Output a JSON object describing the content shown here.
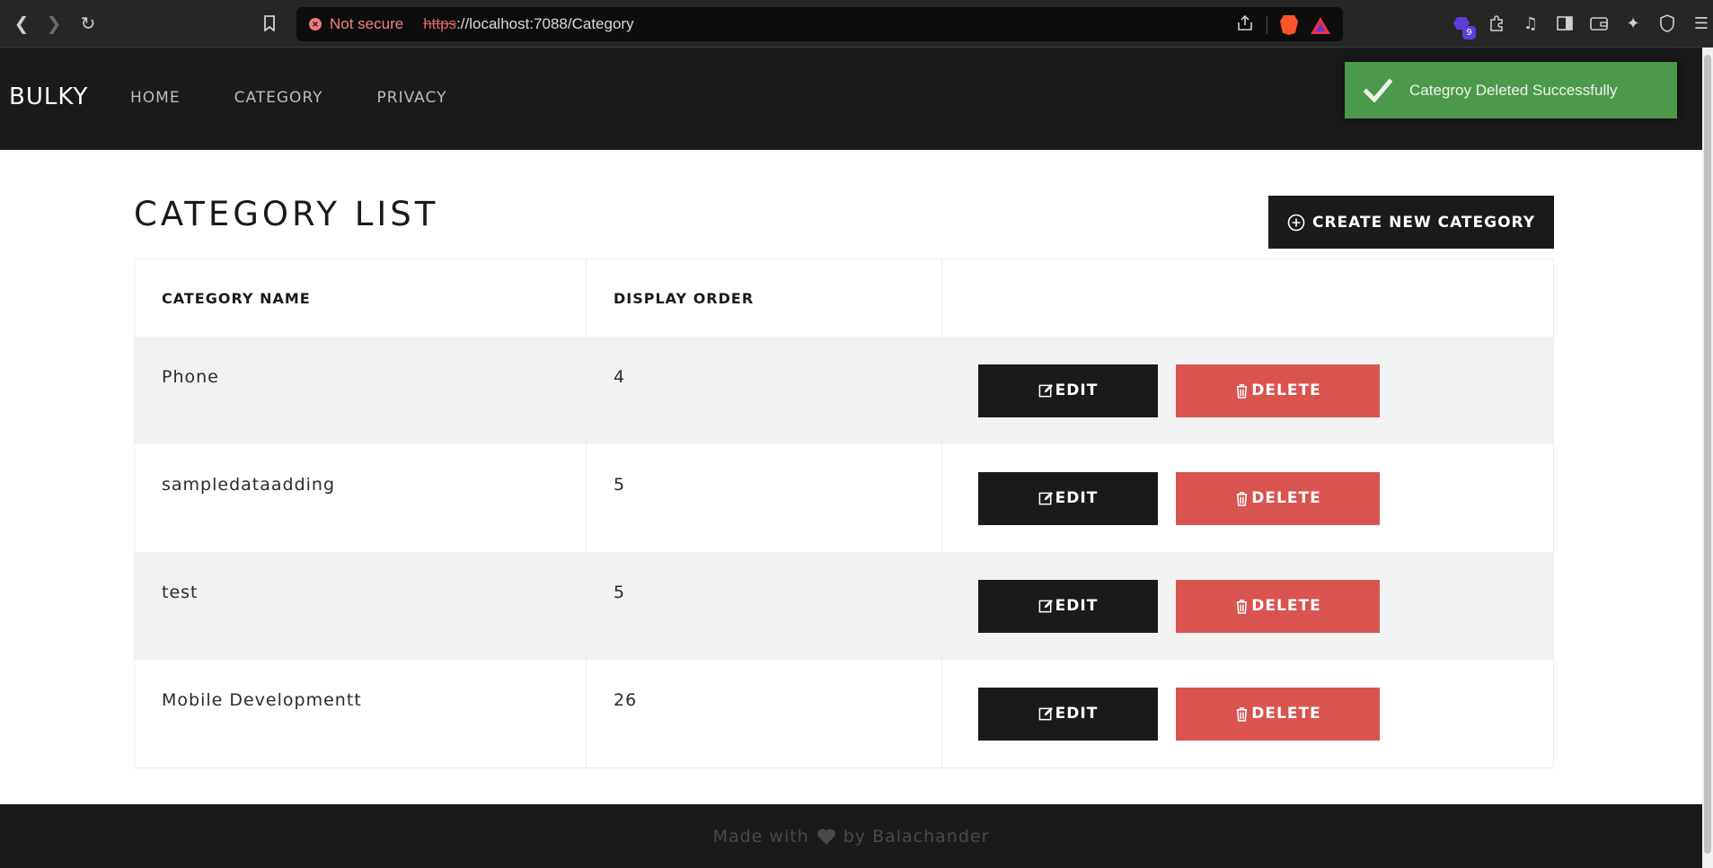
{
  "browser": {
    "security_label": "Not secure",
    "url_scheme": "https",
    "url_rest": "://localhost:7088/Category",
    "extension_badge": "9"
  },
  "navbar": {
    "brand": "BULKY",
    "links": [
      "HOME",
      "CATEGORY",
      "PRIVACY"
    ]
  },
  "toast": {
    "message": "Categroy Deleted Successfully",
    "color": "#4b9a4a"
  },
  "page": {
    "title": "CATEGORY LIST",
    "create_button": "CREATE NEW CATEGORY"
  },
  "table": {
    "headers": [
      "CATEGORY NAME",
      "DISPLAY ORDER",
      ""
    ],
    "edit_label": "EDIT",
    "delete_label": "DELETE",
    "rows": [
      {
        "name": "Phone",
        "order": "4"
      },
      {
        "name": "sampledataadding",
        "order": "5"
      },
      {
        "name": "test",
        "order": "5"
      },
      {
        "name": "Mobile Developmentt",
        "order": "26"
      }
    ]
  },
  "footer": {
    "prefix": "Made with",
    "suffix": "by Balachander"
  },
  "colors": {
    "dark": "#1a1a1a",
    "danger": "#d9534f",
    "success": "#4b9a4a"
  }
}
